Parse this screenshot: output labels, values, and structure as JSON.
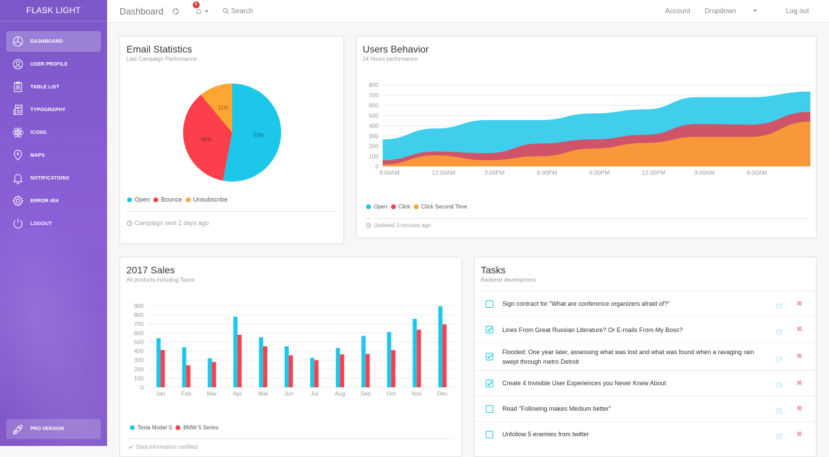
{
  "sidebar": {
    "brand": "FLASK LIGHT",
    "items": [
      {
        "label": "DASHBOARD",
        "icon": "chart-pie-icon",
        "active": true
      },
      {
        "label": "USER PROFILE",
        "icon": "user-circle-icon"
      },
      {
        "label": "TABLE LIST",
        "icon": "clipboard-icon"
      },
      {
        "label": "TYPOGRAPHY",
        "icon": "news-paper-icon"
      },
      {
        "label": "ICONS",
        "icon": "atom-icon"
      },
      {
        "label": "MAPS",
        "icon": "map-pin-icon"
      },
      {
        "label": "NOTIFICATIONS",
        "icon": "bell-icon"
      },
      {
        "label": "ERROR 404",
        "icon": "gear-icon"
      },
      {
        "label": "LOGOUT",
        "icon": "power-icon"
      }
    ],
    "pro": {
      "label": "PRO VERSION",
      "icon": "rocket-icon"
    }
  },
  "topbar": {
    "title": "Dashboard",
    "notifications_count": "5",
    "search_label": "Search",
    "right": [
      "Account",
      "Dropdown",
      "Log out"
    ]
  },
  "email_stats": {
    "title": "Email Statistics",
    "subtitle": "Last Campaign Performance",
    "footer": "Campaign sent 2 days ago"
  },
  "users_behavior": {
    "title": "Users Behavior",
    "subtitle": "24 Hours performance",
    "footer": "Updated 3 minutes ago"
  },
  "sales": {
    "title": "2017 Sales",
    "subtitle": "All products including Taxes",
    "footer": "Data information certified"
  },
  "tasks": {
    "title": "Tasks",
    "subtitle": "Backend development",
    "items": [
      {
        "text": "Sign contract for \"What are conference organizers afraid of?\"",
        "checked": false
      },
      {
        "text": "Lines From Great Russian Literature? Or E-mails From My Boss?",
        "checked": true
      },
      {
        "text": "Flooded: One year later, assessing what was lost and what was found when a ravaging rain swept through metro Detroit",
        "checked": true
      },
      {
        "text": "Create 4 Invisible User Experiences you Never Knew About",
        "checked": true
      },
      {
        "text": "Read \"Following makes Medium better\"",
        "checked": false
      },
      {
        "text": "Unfollow 5 enemies from twitter",
        "checked": false
      }
    ]
  },
  "colors": {
    "cyan": "#1dc7ea",
    "red": "#fb404b",
    "orange": "#ffa534",
    "accent": "#8a5fd6"
  },
  "chart_data": [
    {
      "type": "pie",
      "title": "Email Statistics",
      "categories": [
        "Open",
        "Bounce",
        "Unsubscribe"
      ],
      "values": [
        53,
        36,
        11
      ],
      "labels": [
        "53%",
        "36%",
        "11%"
      ],
      "colors": [
        "#1dc7ea",
        "#fb404b",
        "#ffa534"
      ],
      "legend": "bottom-left"
    },
    {
      "type": "area",
      "title": "Users Behavior",
      "x": [
        "9:00AM",
        "12:00AM",
        "3:00PM",
        "6:00PM",
        "9:00PM",
        "12:00PM",
        "3:00AM",
        "6:00AM",
        ""
      ],
      "xticks": [
        "9:00AM",
        "12:00AM",
        "3:00PM",
        "6:00PM",
        "9:00PM",
        "12:00PM",
        "3:00AM",
        "6:00AM"
      ],
      "yticks": [
        0,
        100,
        200,
        300,
        400,
        500,
        600,
        700,
        800
      ],
      "ylim": [
        0,
        800
      ],
      "grid": true,
      "series": [
        {
          "name": "Open",
          "color": "#1dc7ea",
          "values": [
            265,
            372,
            455,
            455,
            520,
            560,
            680,
            680,
            735
          ]
        },
        {
          "name": "Click",
          "color": "#e0465a",
          "values": [
            60,
            145,
            130,
            225,
            265,
            310,
            415,
            410,
            535
          ]
        },
        {
          "name": "Click Second Time",
          "color": "#ffa534",
          "values": [
            18,
            108,
            60,
            100,
            175,
            230,
            290,
            290,
            440
          ]
        }
      ],
      "legend": "bottom-left"
    },
    {
      "type": "bar",
      "title": "2017 Sales",
      "categories": [
        "Jan",
        "Feb",
        "Mar",
        "Apr",
        "Mai",
        "Jun",
        "Jul",
        "Aug",
        "Sep",
        "Oct",
        "Nov",
        "Dec"
      ],
      "yticks": [
        0,
        100,
        200,
        300,
        400,
        500,
        600,
        700,
        800,
        900
      ],
      "ylim": [
        0,
        900
      ],
      "grid": true,
      "series": [
        {
          "name": "Tesla Model S",
          "color": "#1dc7ea",
          "values": [
            542,
            443,
            320,
            780,
            553,
            453,
            326,
            434,
            568,
            610,
            756,
            895
          ]
        },
        {
          "name": "BMW 5 Series",
          "color": "#fb404b",
          "values": [
            412,
            243,
            280,
            580,
            453,
            353,
            300,
            364,
            368,
            410,
            636,
            695
          ]
        }
      ],
      "legend": "bottom-left"
    }
  ]
}
